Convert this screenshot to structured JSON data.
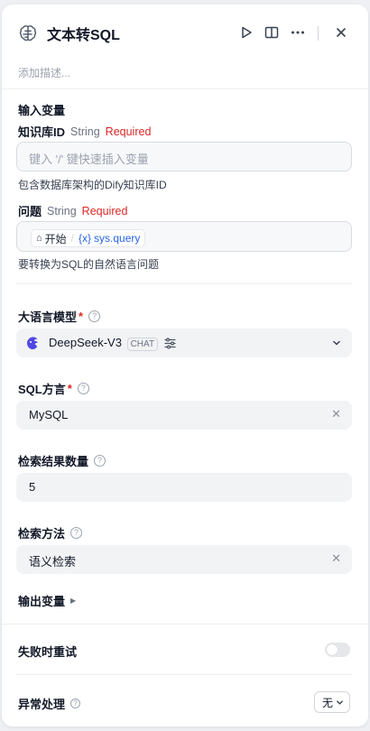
{
  "header": {
    "title": "文本转SQL",
    "description_placeholder": "添加描述..."
  },
  "input_vars": {
    "section_label": "输入变量",
    "knowledge": {
      "label": "知识库ID",
      "type": "String",
      "required": "Required",
      "placeholder": "键入 '/' 键快速插入变量",
      "hint": "包含数据库架构的Dify知识库ID"
    },
    "question": {
      "label": "问题",
      "type": "String",
      "required": "Required",
      "var_node": "开始",
      "var_name": "sys.query",
      "var_prefix": "{x}",
      "hint": "要转换为SQL的自然语言问题"
    }
  },
  "model": {
    "label": "大语言模型",
    "required_mark": "*",
    "name": "DeepSeek-V3",
    "badge": "CHAT"
  },
  "dialect": {
    "label": "SQL方言",
    "required_mark": "*",
    "value": "MySQL"
  },
  "result_count": {
    "label": "检索结果数量",
    "value": "5"
  },
  "retrieval": {
    "label": "检索方法",
    "value": "语义检索"
  },
  "output_vars": {
    "label": "输出变量"
  },
  "retry": {
    "label": "失败时重试",
    "enabled": false
  },
  "error_handling": {
    "label": "异常处理",
    "value": "无"
  },
  "colors": {
    "required": "#dc2626",
    "variable": "#2563eb",
    "model_logo": "#4f46e5"
  }
}
